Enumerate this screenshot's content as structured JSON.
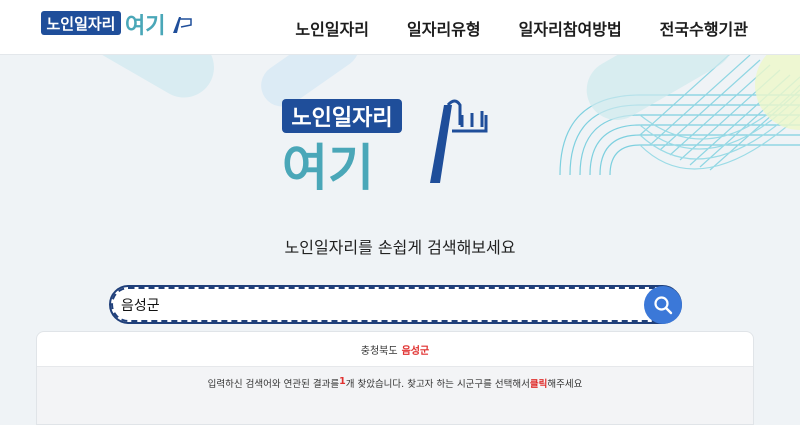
{
  "header": {
    "logo_text_main": "노인일자리",
    "logo_text_sub": "여기",
    "nav": [
      {
        "label": "노인일자리"
      },
      {
        "label": "일자리유형"
      },
      {
        "label": "일자리참여방법"
      },
      {
        "label": "전국수행기관"
      }
    ]
  },
  "hero": {
    "logo_line1": "노인일자리",
    "logo_line2": "여기",
    "tagline": "노인일자리를 손쉽게 검색해보세요"
  },
  "search": {
    "value": "음성군",
    "placeholder": ""
  },
  "results": {
    "items": [
      {
        "region": "충청북도",
        "name": "음성군"
      }
    ],
    "message": {
      "part1": "입력하신 검색어와 연관된 결과를 ",
      "count": "1",
      "part2": "개 찾았습니다. 찾고자 하는 시군구를 선택해서 ",
      "click": "클릭",
      "part3": "해주세요"
    }
  },
  "colors": {
    "brand_blue": "#1f4e9a",
    "brand_teal": "#4aa7b8",
    "search_button": "#3b78d8",
    "highlight_red": "#e0302f"
  },
  "icons": {
    "search_button": "search-icon"
  }
}
